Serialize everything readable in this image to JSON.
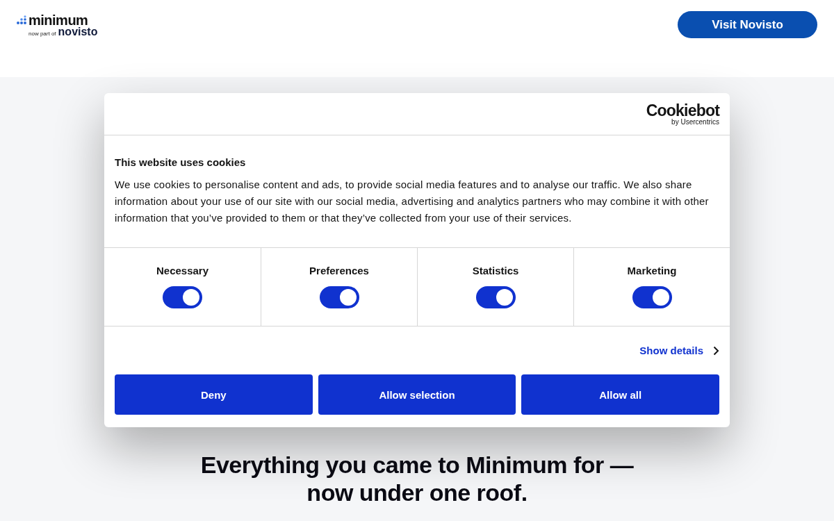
{
  "header": {
    "logo": {
      "name": "minimum",
      "tagline": "now part of",
      "partner": "novisto"
    },
    "button": "Visit Novisto"
  },
  "headline": [
    "Everything you came to Minimum for —",
    "now under one roof."
  ],
  "cookie_dialog": {
    "brand": "Cookiebot",
    "brand_sub": "by Usercentrics",
    "title": "This website uses cookies",
    "text": "We use cookies to personalise content and ads, to provide social media features and to analyse our traffic. We also share information about your use of our site with our social media, advertising and analytics partners who may combine it with other information that you’ve provided to them or that they’ve collected from your use of their services.",
    "categories": [
      {
        "label": "Necessary",
        "checked": true
      },
      {
        "label": "Preferences",
        "checked": true
      },
      {
        "label": "Statistics",
        "checked": true
      },
      {
        "label": "Marketing",
        "checked": true
      }
    ],
    "details_link": "Show details",
    "buttons": [
      "Deny",
      "Allow selection",
      "Allow all"
    ]
  }
}
